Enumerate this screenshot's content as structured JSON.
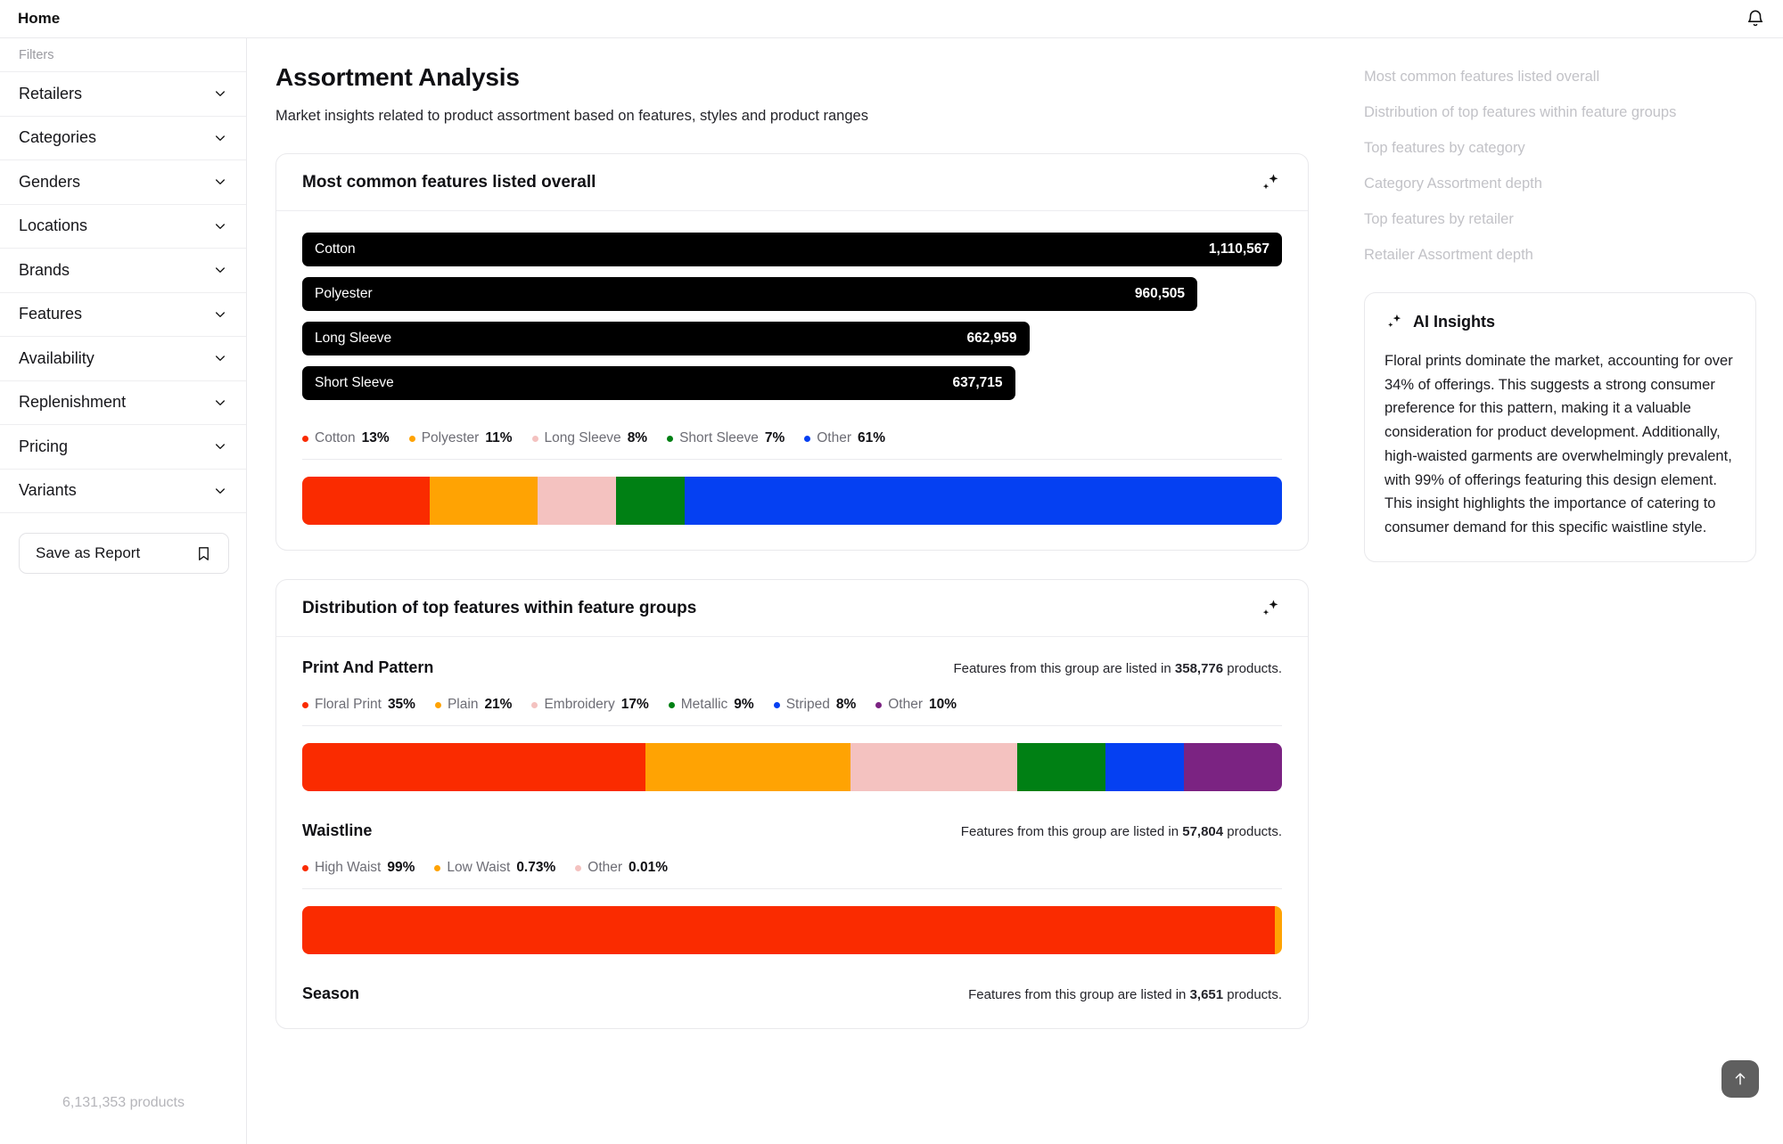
{
  "topbar": {
    "title": "Home",
    "bell_icon": "bell-icon"
  },
  "sidebar": {
    "filters_label": "Filters",
    "items": [
      {
        "label": "Retailers"
      },
      {
        "label": "Categories"
      },
      {
        "label": "Genders"
      },
      {
        "label": "Locations"
      },
      {
        "label": "Brands"
      },
      {
        "label": "Features"
      },
      {
        "label": "Availability"
      },
      {
        "label": "Replenishment"
      },
      {
        "label": "Pricing"
      },
      {
        "label": "Variants"
      }
    ],
    "save_label": "Save as Report",
    "save_icon": "bookmark-icon",
    "product_count": "6,131,353 products"
  },
  "main": {
    "title": "Assortment Analysis",
    "subtitle": "Market insights related to product assortment based on features, styles and product ranges",
    "card1": {
      "title": "Most common features listed overall",
      "sparkle_icon": "sparkle-ai-icon"
    },
    "card2": {
      "title": "Distribution of top features within feature groups",
      "sparkle_icon": "sparkle-ai-icon"
    }
  },
  "rail": {
    "links": [
      "Most common features listed overall",
      "Distribution of top features within feature groups",
      "Top features by category",
      "Category Assortment depth",
      "Top features by retailer",
      "Retailer Assortment depth"
    ],
    "ai": {
      "title": "AI Insights",
      "icon": "sparkle-ai-icon",
      "body": "Floral prints dominate the market, accounting for over 34% of offerings. This suggests a strong consumer preference for this pattern, making it a valuable consideration for product development. Additionally, high-waisted garments are overwhelmingly prevalent, with 99% of offerings featuring this design element. This insight highlights the importance of catering to consumer demand for this specific waistline style."
    }
  },
  "to_top": {
    "icon": "arrow-up-icon"
  },
  "palette": {
    "red": "#FA2B00",
    "orange": "#FFA303",
    "pink": "#F4C2C0",
    "green": "#008014",
    "blue": "#0540F2",
    "purple": "#7B2382"
  },
  "chart_data": [
    {
      "type": "bar",
      "title": "Most common features listed overall",
      "orientation": "horizontal",
      "categories": [
        "Cotton",
        "Polyester",
        "Long Sleeve",
        "Short Sleeve"
      ],
      "values": [
        1110567,
        960505,
        662959,
        637715
      ],
      "value_labels": [
        "1,110,567",
        "960,505",
        "662,959",
        "637,715"
      ],
      "bar_color": "#000000",
      "xlabel": "",
      "ylabel": "",
      "grid": false,
      "legend": "none"
    },
    {
      "type": "bar",
      "subtype": "stacked-100",
      "title": "Most common features listed overall — share",
      "categories": [
        "Cotton",
        "Polyester",
        "Long Sleeve",
        "Short Sleeve",
        "Other"
      ],
      "values": [
        13,
        11,
        8,
        7,
        61
      ],
      "value_labels": [
        "13%",
        "11%",
        "8%",
        "7%",
        "61%"
      ],
      "colors": [
        "#FA2B00",
        "#FFA303",
        "#F4C2C0",
        "#008014",
        "#0540F2"
      ],
      "legend": "top",
      "ylim": [
        0,
        100
      ]
    },
    {
      "type": "bar",
      "subtype": "stacked-100",
      "title": "Print And Pattern",
      "meta_prefix": "Features from this group are listed in",
      "meta_value": "358,776",
      "meta_suffix": "products.",
      "categories": [
        "Floral Print",
        "Plain",
        "Embroidery",
        "Metallic",
        "Striped",
        "Other"
      ],
      "values": [
        35,
        21,
        17,
        9,
        8,
        10
      ],
      "value_labels": [
        "35%",
        "21%",
        "17%",
        "9%",
        "8%",
        "10%"
      ],
      "colors": [
        "#FA2B00",
        "#FFA303",
        "#F4C2C0",
        "#008014",
        "#0540F2",
        "#7B2382"
      ],
      "legend": "top",
      "ylim": [
        0,
        100
      ]
    },
    {
      "type": "bar",
      "subtype": "stacked-100",
      "title": "Waistline",
      "meta_prefix": "Features from this group are listed in",
      "meta_value": "57,804",
      "meta_suffix": "products.",
      "categories": [
        "High Waist",
        "Low Waist",
        "Other"
      ],
      "values": [
        99,
        0.73,
        0.01
      ],
      "value_labels": [
        "99%",
        "0.73%",
        "0.01%"
      ],
      "colors": [
        "#FA2B00",
        "#FFA303",
        "#F4C2C0"
      ],
      "legend": "top",
      "ylim": [
        0,
        100
      ]
    },
    {
      "type": "bar",
      "subtype": "stacked-100",
      "title": "Season",
      "meta_prefix": "Features from this group are listed in",
      "meta_value": "3,651",
      "meta_suffix": "products.",
      "categories": [],
      "values": [],
      "value_labels": [],
      "colors": [],
      "legend": "top",
      "note": "section clipped at viewport bottom"
    }
  ]
}
